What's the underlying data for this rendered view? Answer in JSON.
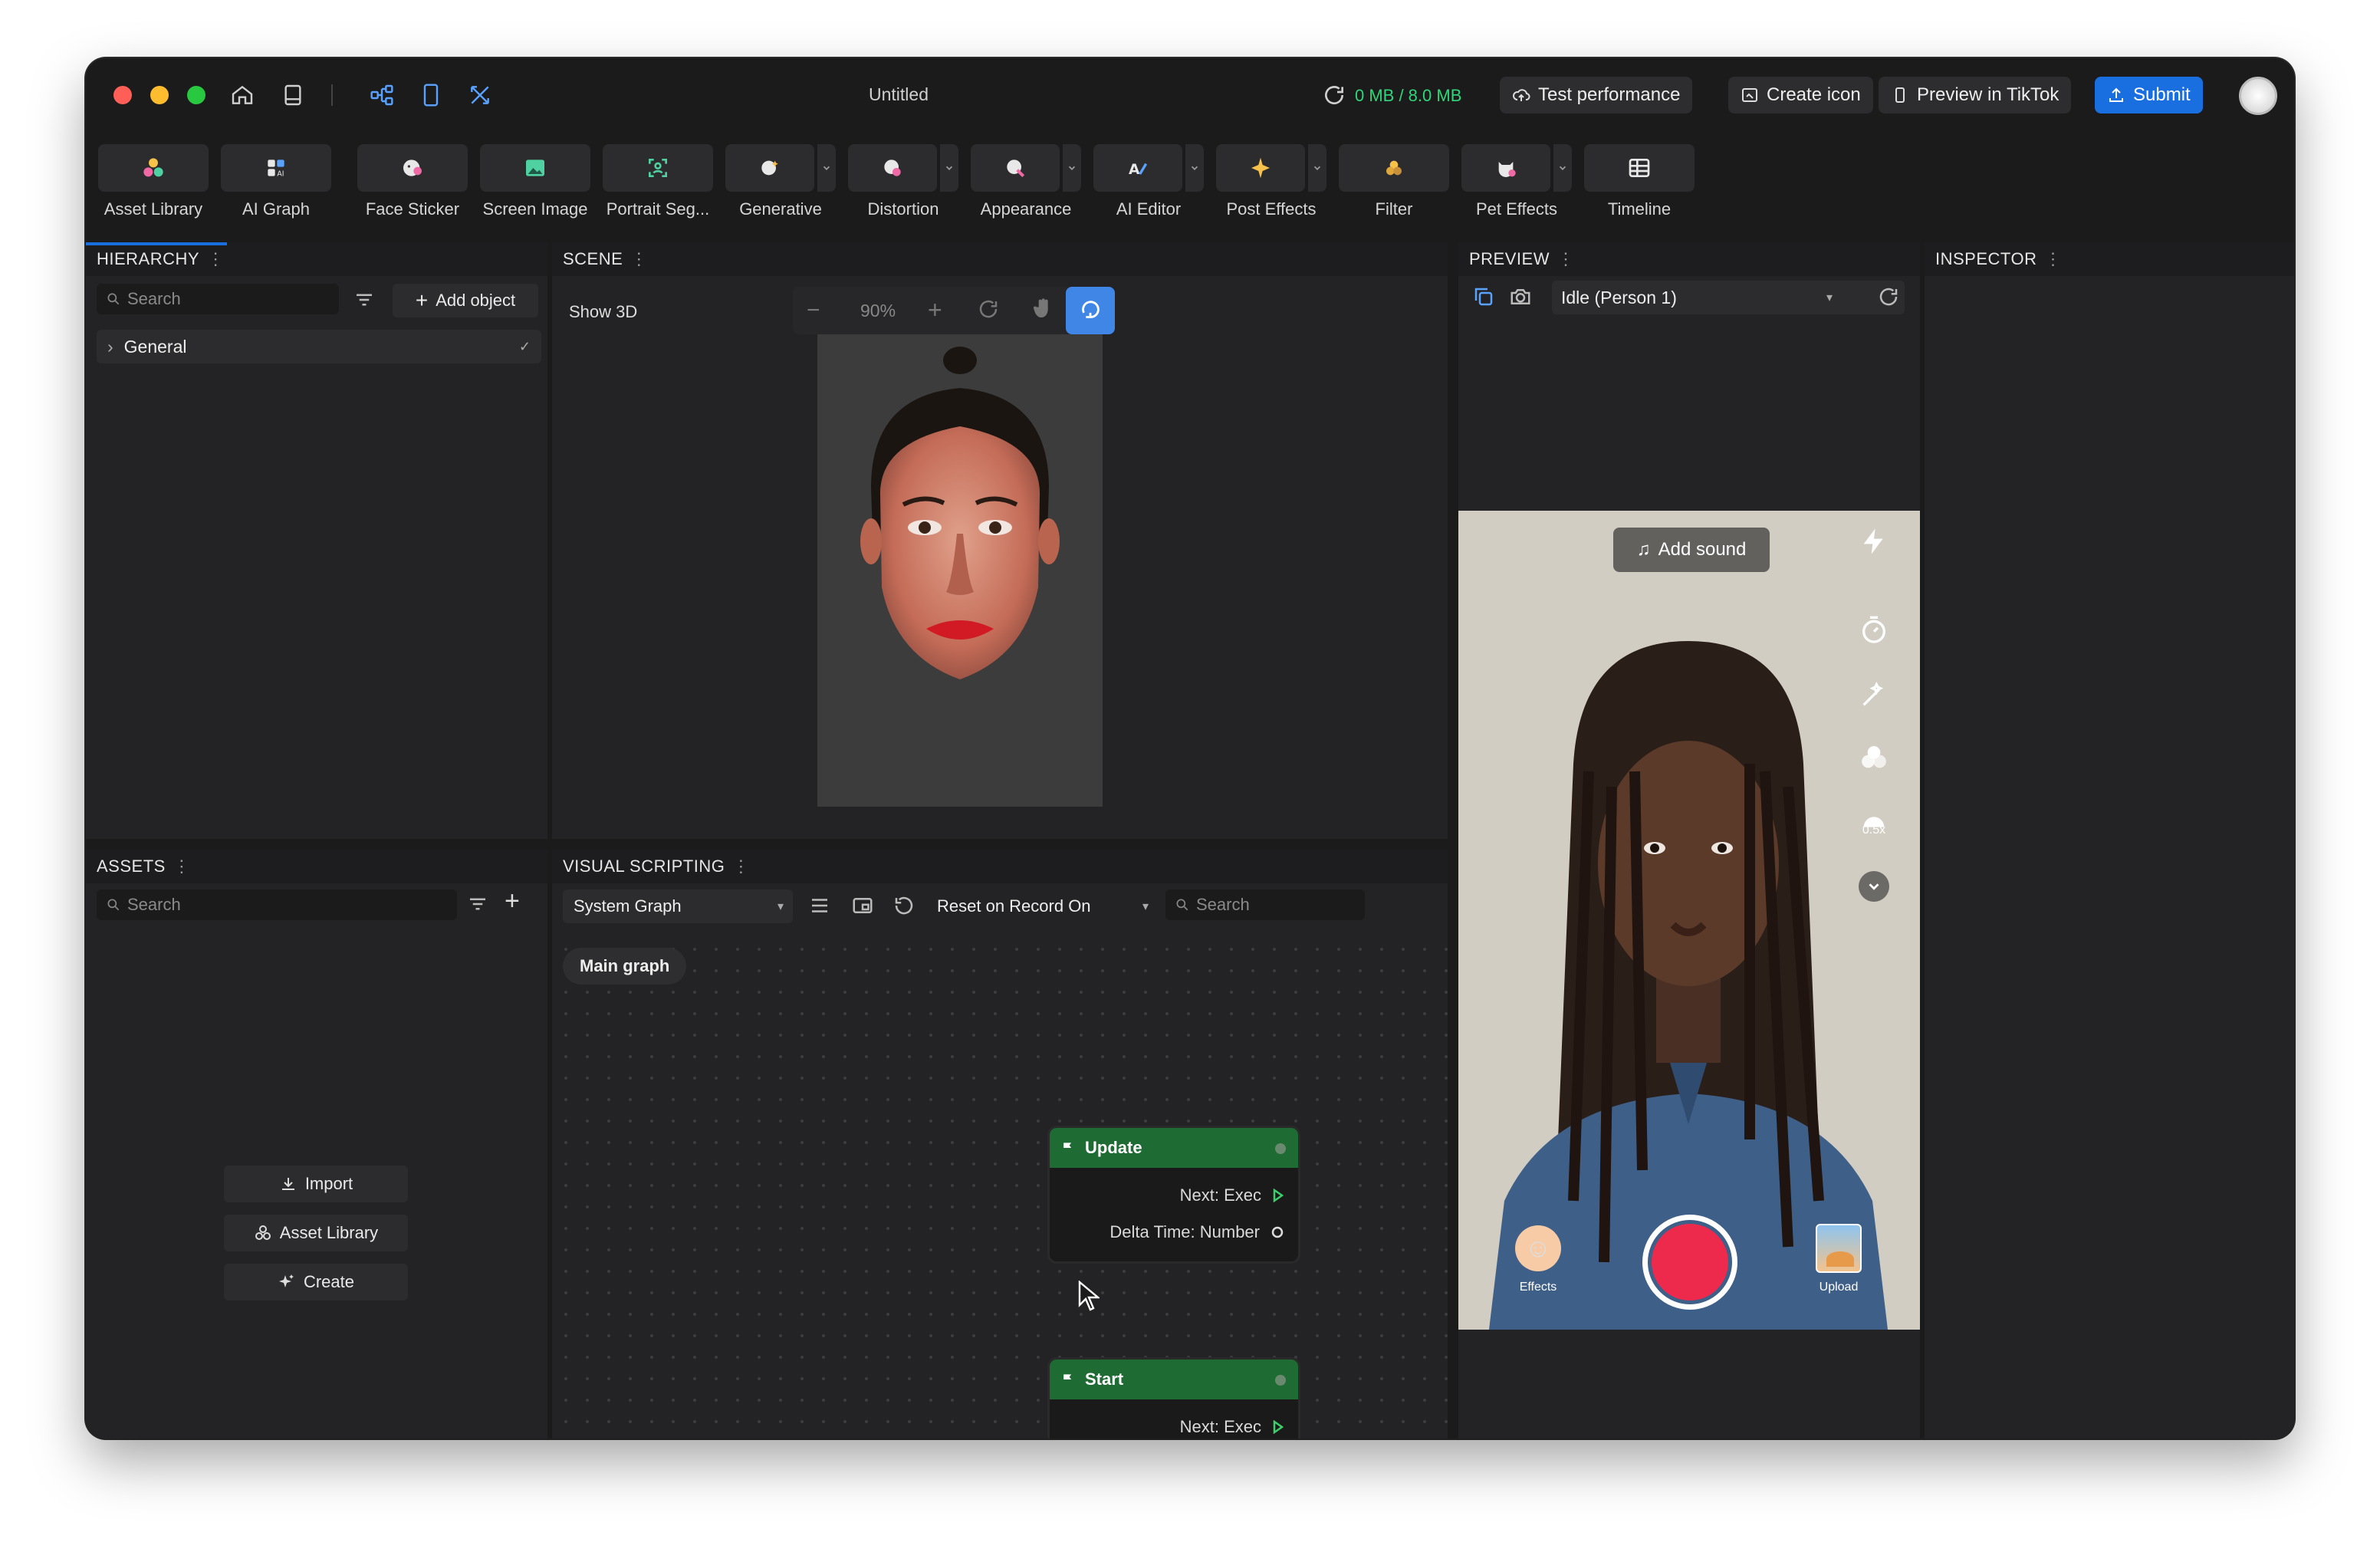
{
  "titlebar": {
    "title": "Untitled",
    "memory": "0 MB / 8.0 MB",
    "test_performance": "Test performance",
    "create_icon": "Create icon",
    "preview_tiktok": "Preview in TikTok",
    "submit": "Submit"
  },
  "toolbar": {
    "items": [
      {
        "label": "Asset Library",
        "icon": "asset-library-icon"
      },
      {
        "label": "AI Graph",
        "icon": "ai-graph-icon"
      },
      {
        "label": "Face Sticker",
        "icon": "face-sticker-icon"
      },
      {
        "label": "Screen Image",
        "icon": "screen-image-icon"
      },
      {
        "label": "Portrait Seg...",
        "icon": "portrait-seg-icon"
      },
      {
        "label": "Generative",
        "icon": "generative-icon"
      },
      {
        "label": "Distortion",
        "icon": "distortion-icon"
      },
      {
        "label": "Appearance",
        "icon": "appearance-icon"
      },
      {
        "label": "AI Editor",
        "icon": "ai-editor-icon"
      },
      {
        "label": "Post Effects",
        "icon": "post-effects-icon"
      },
      {
        "label": "Filter",
        "icon": "filter-icon"
      },
      {
        "label": "Pet Effects",
        "icon": "pet-effects-icon"
      },
      {
        "label": "Timeline",
        "icon": "timeline-icon"
      }
    ]
  },
  "hierarchy": {
    "title": "HIERARCHY",
    "search_placeholder": "Search",
    "add_object": "Add object",
    "general": "General"
  },
  "scene": {
    "title": "SCENE",
    "show3d": "Show 3D",
    "zoom": "90%"
  },
  "preview": {
    "title": "PREVIEW",
    "mode": "Idle (Person 1)",
    "add_sound": "Add sound",
    "speed": "0.5x",
    "effects": "Effects",
    "upload": "Upload"
  },
  "inspector": {
    "title": "INSPECTOR"
  },
  "assets": {
    "title": "ASSETS",
    "search_placeholder": "Search",
    "import": "Import",
    "asset_library": "Asset Library",
    "create": "Create"
  },
  "visual_scripting": {
    "title": "VISUAL SCRIPTING",
    "graph_select": "System Graph",
    "reset_select": "Reset on Record On",
    "search_placeholder": "Search",
    "main_graph": "Main graph",
    "nodes": [
      {
        "title": "Update",
        "rows": [
          "Next: Exec",
          "Delta Time: Number"
        ]
      },
      {
        "title": "Start",
        "rows": [
          "Next: Exec"
        ]
      }
    ]
  },
  "colors": {
    "accent": "#1a6fe0",
    "node_header": "#1f6b34",
    "record": "#ee2a4c",
    "memory": "#2fd67a"
  }
}
